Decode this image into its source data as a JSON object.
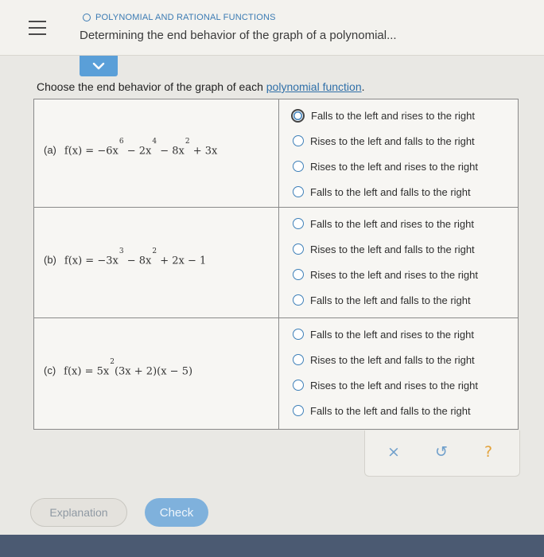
{
  "header": {
    "topic": "POLYNOMIAL AND RATIONAL FUNCTIONS",
    "title": "Determining the end behavior of the graph of a polynomial..."
  },
  "prompt": {
    "text": "Choose the end behavior of the graph of each ",
    "link": "polynomial function",
    "end": "."
  },
  "problems": [
    {
      "label": "(a)",
      "lhs": "f(x) = ",
      "terms": [
        {
          "text": "−6x",
          "exp": "6"
        },
        {
          "text": " − 2x",
          "exp": "4"
        },
        {
          "text": " − 8x",
          "exp": "2"
        },
        {
          "text": " + 3x",
          "exp": ""
        }
      ],
      "options": [
        "Falls to the left and rises to the right",
        "Rises to the left and falls to the right",
        "Rises to the left and rises to the right",
        "Falls to the left and falls to the right"
      ]
    },
    {
      "label": "(b)",
      "lhs": "f(x) = ",
      "terms": [
        {
          "text": "−3x",
          "exp": "3"
        },
        {
          "text": " − 8x",
          "exp": "2"
        },
        {
          "text": " + 2x − 1",
          "exp": ""
        }
      ],
      "options": [
        "Falls to the left and rises to the right",
        "Rises to the left and falls to the right",
        "Rises to the left and rises to the right",
        "Falls to the left and falls to the right"
      ]
    },
    {
      "label": "(c)",
      "lhs": "f(x) = ",
      "terms": [
        {
          "text": "5x",
          "exp": "2"
        },
        {
          "text": "(3x + 2)(x − 5)",
          "exp": ""
        }
      ],
      "options": [
        "Falls to the left and rises to the right",
        "Rises to the left and falls to the right",
        "Rises to the left and rises to the right",
        "Falls to the left and falls to the right"
      ]
    }
  ],
  "actions": {
    "clear": "×",
    "undo": "↺",
    "help": "?"
  },
  "buttons": {
    "explanation": "Explanation",
    "check": "Check"
  },
  "colors": {
    "accent": "#5a9fd8",
    "link": "#2f6fa8",
    "check_button": "#7fb1dc",
    "clear_icon": "#6f9fcb",
    "undo_icon": "#6f9fcb",
    "help_icon": "#e3a23a"
  }
}
